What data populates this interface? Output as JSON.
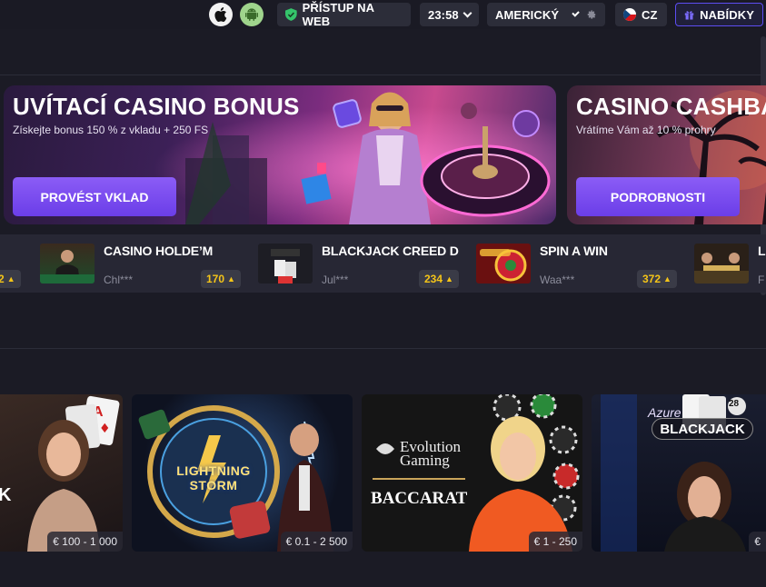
{
  "topbar": {
    "web_access": "PŘÍSTUP NA WEB",
    "time": "23:58",
    "odds_format": "AMERICKÝ",
    "language": "CZ",
    "offers": "NABÍDKY"
  },
  "banners": [
    {
      "title": "UVÍTACÍ CASINO BONUS",
      "subtitle": "Získejte bonus 150 % z vkladu + 250 FS",
      "button": "PROVÉST VKLAD"
    },
    {
      "title": "CASINO CASHBACK",
      "subtitle": "Vrátíme Vám až 10 % prohry",
      "button": "PODROBNOSTI"
    }
  ],
  "wins": [
    {
      "game": "",
      "user": "",
      "amount": "2"
    },
    {
      "game": "CASINO HOLDE’M",
      "user": "Chl***",
      "amount": "170"
    },
    {
      "game": "BLACKJACK CREED D",
      "user": "Jul***",
      "amount": "234"
    },
    {
      "game": "SPIN A WIN",
      "user": "Waa***",
      "amount": "372"
    },
    {
      "game": "L",
      "user": "F",
      "amount": ""
    }
  ],
  "tiles": [
    {
      "name": "K",
      "limit": "€ 100 - 1 000"
    },
    {
      "name": "LIGHTNING STORM",
      "limit": "€ 0.1 - 2 500"
    },
    {
      "name": "BACCARAT",
      "provider": "Evolution Gaming",
      "limit": "€ 1 - 250"
    },
    {
      "name": "BLACKJACK",
      "brand": "Azure",
      "seat": "28",
      "limit": "€"
    }
  ],
  "colors": {
    "accent": "#6b3ee8",
    "gold": "#f5c518",
    "bg": "#1b1b25"
  }
}
